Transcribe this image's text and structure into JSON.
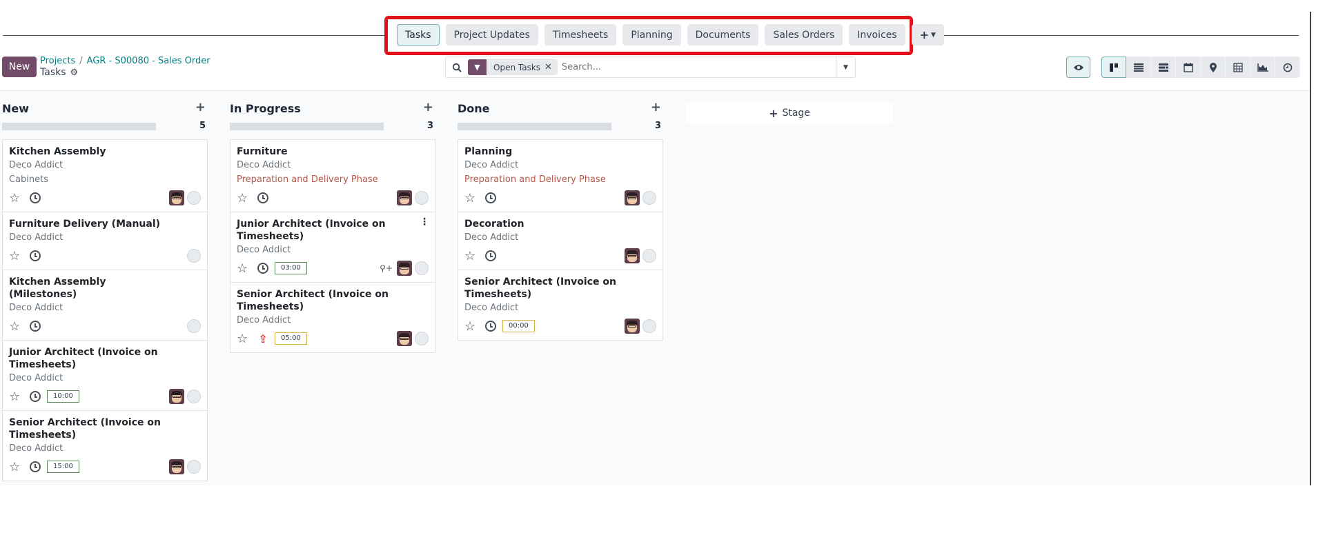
{
  "tabs": [
    {
      "label": "Tasks",
      "active": true
    },
    {
      "label": "Project Updates",
      "active": false
    },
    {
      "label": "Timesheets",
      "active": false
    },
    {
      "label": "Planning",
      "active": false
    },
    {
      "label": "Documents",
      "active": false
    },
    {
      "label": "Sales Orders",
      "active": false
    },
    {
      "label": "Invoices",
      "active": false
    }
  ],
  "tabs_more": {
    "icon": "plus-icon",
    "caret": "caret-down-icon"
  },
  "control_panel": {
    "new_label": "New",
    "breadcrumb": [
      {
        "label": "Projects"
      },
      {
        "label": "AGR - S00080 - Sales Order"
      }
    ],
    "breadcrumb_separator": "/",
    "current": "Tasks",
    "gear_icon": "gear-icon"
  },
  "search": {
    "facet_label": "Open Tasks",
    "facet_icon": "filter-icon",
    "placeholder": "Search..."
  },
  "views": [
    "kanban-icon",
    "list-icon",
    "gantt-icon",
    "calendar-icon",
    "map-icon",
    "pivot-icon",
    "graph-icon",
    "activity-icon"
  ],
  "colors": {
    "brand": "#714b67",
    "accent": "#017e84",
    "tag": "#b45648",
    "highlight": "#e0101a"
  },
  "kanban": {
    "add_stage_label": "Stage",
    "columns": [
      {
        "title": "New",
        "count": "5",
        "cards": [
          {
            "title": "Kitchen Assembly",
            "customer": "Deco Addict",
            "extra": "Cabinets",
            "extra_is_tag": false,
            "hours": null,
            "avatar": true
          },
          {
            "title": "Furniture Delivery (Manual)",
            "customer": "Deco Addict",
            "extra": null,
            "hours": null,
            "avatar": false
          },
          {
            "title": "Kitchen Assembly (Milestones)",
            "customer": "Deco Addict",
            "extra": null,
            "hours": null,
            "avatar": false
          },
          {
            "title": "Junior Architect (Invoice on Timesheets)",
            "customer": "Deco Addict",
            "extra": null,
            "hours": "10:00",
            "avatar": true
          },
          {
            "title": "Senior Architect (Invoice on Timesheets)",
            "customer": "Deco Addict",
            "extra": null,
            "hours": "15:00",
            "avatar": true
          }
        ]
      },
      {
        "title": "In Progress",
        "count": "3",
        "cards": [
          {
            "title": "Furniture",
            "customer": "Deco Addict",
            "extra": "Preparation and Delivery Phase",
            "extra_is_tag": true,
            "hours": null,
            "avatar": true
          },
          {
            "title": "Junior Architect (Invoice on Timesheets)",
            "customer": "Deco Addict",
            "extra": null,
            "hours": "03:00",
            "avatar": true,
            "assign": true,
            "menu": true
          },
          {
            "title": "Senior Architect (Invoice on Timesheets)",
            "customer": "Deco Addict",
            "extra": null,
            "hours": "05:00",
            "hours_warn": true,
            "avatar": true,
            "upload": true
          }
        ]
      },
      {
        "title": "Done",
        "count": "3",
        "cards": [
          {
            "title": "Planning",
            "customer": "Deco Addict",
            "extra": "Preparation and Delivery Phase",
            "extra_is_tag": true,
            "hours": null,
            "avatar": true
          },
          {
            "title": "Decoration",
            "customer": "Deco Addict",
            "extra": null,
            "hours": null,
            "avatar": true
          },
          {
            "title": "Senior Architect (Invoice on Timesheets)",
            "customer": "Deco Addict",
            "extra": null,
            "hours": "00:00",
            "hours_warn": true,
            "avatar": true
          }
        ]
      }
    ]
  }
}
